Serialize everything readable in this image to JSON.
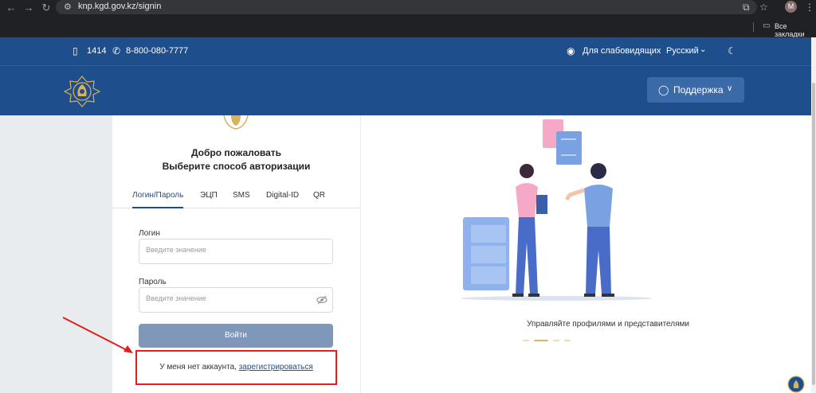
{
  "browser": {
    "url": "knp.kgd.gov.kz/signin",
    "bookmarks_label": "Все закладки",
    "profile_initial": "M"
  },
  "topbar": {
    "short_number": "1414",
    "phone": "8-800-080-7777",
    "accessibility": "Для слабовидящих",
    "language": "Русский"
  },
  "header": {
    "support_label": "Поддержка"
  },
  "login_card": {
    "welcome": "Добро пожаловать",
    "subtitle": "Выберите способ авторизации",
    "tabs": [
      {
        "label": "Логин/Пароль",
        "active": true
      },
      {
        "label": "ЭЦП",
        "active": false
      },
      {
        "label": "SMS",
        "active": false
      },
      {
        "label": "Digital-ID",
        "active": false
      },
      {
        "label": "QR",
        "active": false
      }
    ],
    "login_label": "Логин",
    "login_placeholder": "Введите значение",
    "password_label": "Пароль",
    "password_placeholder": "Введите значение",
    "submit_label": "Войти",
    "no_account_text": "У меня нет аккаунта, ",
    "register_link": "зарегистрироваться"
  },
  "promo": {
    "caption": "Управляйте профилями и представителями"
  },
  "colors": {
    "brand_blue": "#1f4e8c",
    "highlight_red": "#e21f1f",
    "accent_gold": "#e3b65a"
  }
}
